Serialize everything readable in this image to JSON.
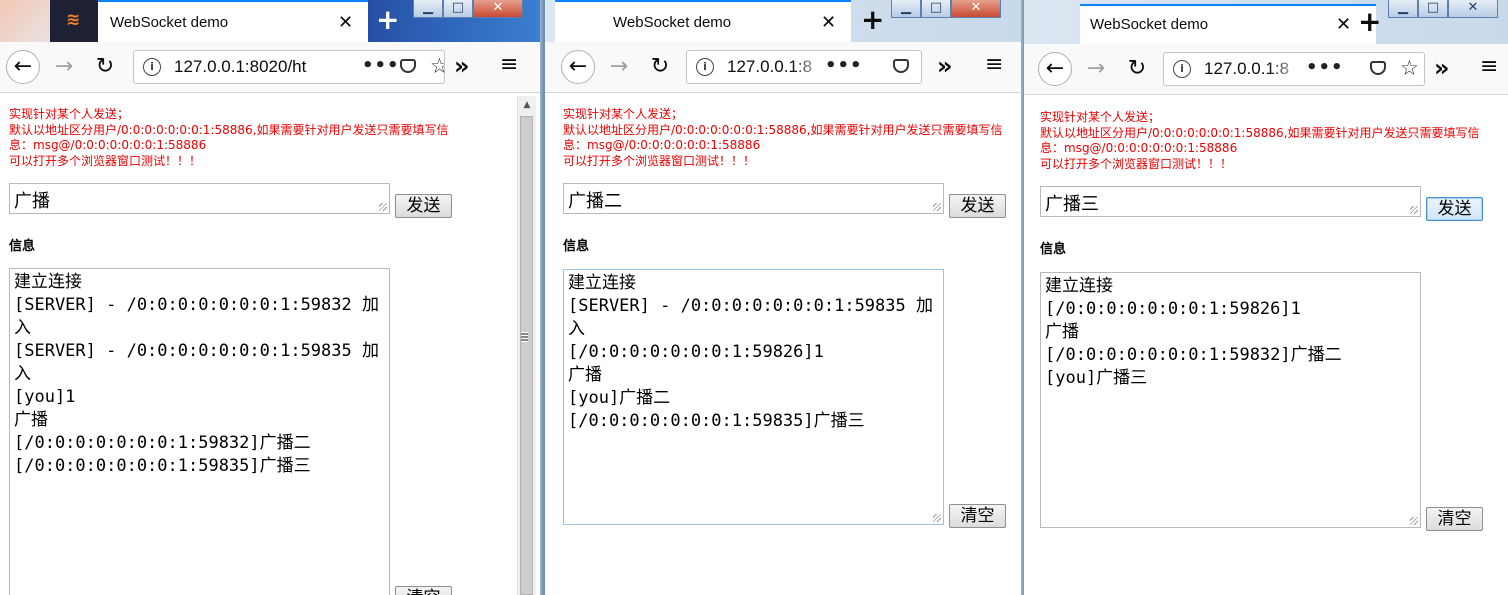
{
  "windows": [
    {
      "tab_title": "WebSocket demo",
      "url": "127.0.0.1:8020/ht",
      "notice": [
        "实现针对某个人发送；",
        "默认以地址区分用户/0:0:0:0:0:0:0:1:58886,如果需要针对用户发送只需要填写信",
        "息：msg@/0:0:0:0:0:0:0:1:58886",
        "可以打开多个浏览器窗口测试！！！"
      ],
      "message_input": "广播",
      "send_label": "发送",
      "info_label": "信息",
      "log": [
        "建立连接",
        "[SERVER] - /0:0:0:0:0:0:0:1:59832 加",
        "入",
        "[SERVER] - /0:0:0:0:0:0:0:1:59835 加",
        "入",
        "[you]1",
        "广播",
        "[/0:0:0:0:0:0:0:1:59832]广播二",
        "[/0:0:0:0:0:0:0:1:59835]广播三"
      ],
      "clear_label": "清空"
    },
    {
      "tab_title": "WebSocket demo",
      "url": "127.0.0.1:8",
      "notice": [
        "实现针对某个人发送；",
        "默认以地址区分用户/0:0:0:0:0:0:0:1:58886,如果需要针对用户发送只需要填写信",
        "息：msg@/0:0:0:0:0:0:0:1:58886",
        "可以打开多个浏览器窗口测试！！！"
      ],
      "message_input": "广播二",
      "send_label": "发送",
      "info_label": "信息",
      "log": [
        "建立连接",
        "[SERVER] - /0:0:0:0:0:0:0:1:59835 加",
        "入",
        "[/0:0:0:0:0:0:0:1:59826]1",
        "广播",
        "[you]广播二",
        "[/0:0:0:0:0:0:0:1:59835]广播三"
      ],
      "clear_label": "清空"
    },
    {
      "tab_title": "WebSocket demo",
      "url": "127.0.0.1:8",
      "notice": [
        "实现针对某个人发送；",
        "默认以地址区分用户/0:0:0:0:0:0:0:1:58886,如果需要针对用户发送只需要填写信",
        "息：msg@/0:0:0:0:0:0:0:1:58886",
        "可以打开多个浏览器窗口测试！！！"
      ],
      "message_input": "广播三",
      "send_label": "发送",
      "info_label": "信息",
      "log": [
        "建立连接",
        "[/0:0:0:0:0:0:0:1:59826]1",
        "广播",
        "[/0:0:0:0:0:0:0:1:59832]广播二",
        "[you]广播三"
      ],
      "clear_label": "清空"
    }
  ],
  "icons": {
    "back": "←",
    "forward": "→",
    "reload": "↻",
    "info": "i",
    "more": "•••",
    "star": "☆",
    "overflow": "»",
    "menu": "≡",
    "close_tab": "✕",
    "new_tab": "+",
    "minimize": "▁",
    "maximize": "□",
    "close_window": "✕"
  }
}
